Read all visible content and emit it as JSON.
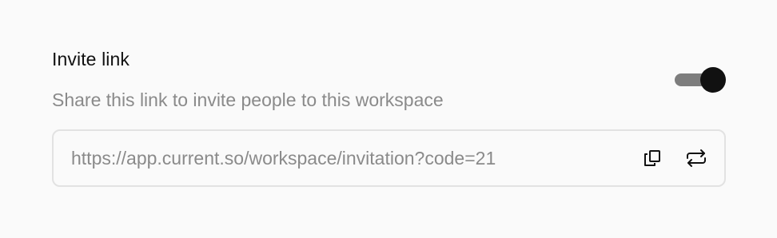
{
  "invite": {
    "title": "Invite link",
    "description": "Share this link to invite people to this workspace",
    "enabled": true,
    "link": "https://app.current.so/workspace/invitation?code=21"
  },
  "icons": {
    "copy": "copy-icon",
    "refresh": "refresh-icon"
  },
  "colors": {
    "title": "#111111",
    "muted": "#8a8a8a",
    "border": "#e2e2e2",
    "toggle_thumb": "#111111",
    "toggle_track": "#7d7d7d"
  }
}
